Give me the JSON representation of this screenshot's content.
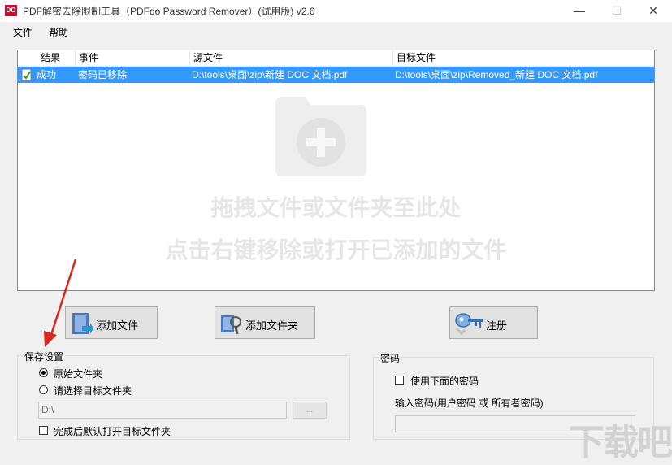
{
  "window": {
    "icon_text": "DO",
    "title": "PDF解密去除限制工具（PDFdo Password Remover）(试用版) v2.6",
    "minimize": "—",
    "maximize": "☐",
    "close": "✕"
  },
  "menu": [
    {
      "label": "文件"
    },
    {
      "label": "帮助"
    }
  ],
  "table": {
    "columns": [
      "结果",
      "事件",
      "源文件",
      "目标文件"
    ],
    "rows": [
      {
        "status": "成功",
        "event": "密码已移除",
        "source": "D:\\tools\\桌面\\zip\\新建 DOC 文档.pdf",
        "target": "D:\\tools\\桌面\\zip\\Removed_新建 DOC 文档.pdf"
      }
    ],
    "drop_hint_1": "拖拽文件或文件夹至此处",
    "drop_hint_2": "点击右键移除或打开已添加的文件"
  },
  "buttons": {
    "add_file": "添加文件",
    "add_folder": "添加文件夹",
    "register": "注册"
  },
  "save_settings": {
    "title": "保存设置",
    "option_original": "原始文件夹",
    "option_select": "请选择目标文件夹",
    "selected": "original",
    "path_value": "D:\\",
    "browse_label": "...",
    "open_after": "完成后默认打开目标文件夹"
  },
  "password": {
    "title": "密码",
    "use_below": "使用下面的密码",
    "input_label": "输入密码(用户密码 或 所有者密码)",
    "input_value": ""
  },
  "colors": {
    "selection": "#3399ff",
    "annotation_arrow": "#d9261c",
    "app_icon": "#c8102e"
  },
  "icons": [
    "app-icon",
    "success-doc-icon",
    "add-folder-watermark-icon",
    "add-file-icon",
    "add-folder-icon",
    "key-icon",
    "red-annotation-arrow"
  ],
  "watermark": "下载吧"
}
